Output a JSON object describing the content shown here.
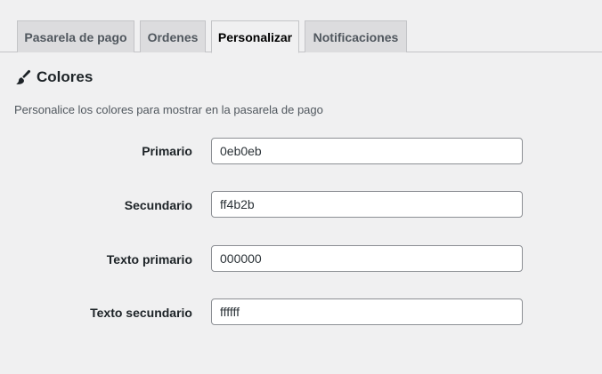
{
  "tabs": [
    {
      "label": "Pasarela de pago",
      "active": false
    },
    {
      "label": "Ordenes",
      "active": false
    },
    {
      "label": "Personalizar",
      "active": true
    },
    {
      "label": "Notificaciones",
      "active": false
    }
  ],
  "section": {
    "icon": "paintbrush-icon",
    "title": "Colores",
    "description": "Personalice los colores para mostrar en la pasarela de pago"
  },
  "fields": [
    {
      "label": "Primario",
      "value": "0eb0eb"
    },
    {
      "label": "Secundario",
      "value": "ff4b2b"
    },
    {
      "label": "Texto primario",
      "value": "000000"
    },
    {
      "label": "Texto secundario",
      "value": "ffffff"
    }
  ],
  "colors": {
    "background": "#f0f0f1",
    "tab_inactive": "#dcdcde",
    "border": "#c3c4c7",
    "text": "#1d2327"
  }
}
